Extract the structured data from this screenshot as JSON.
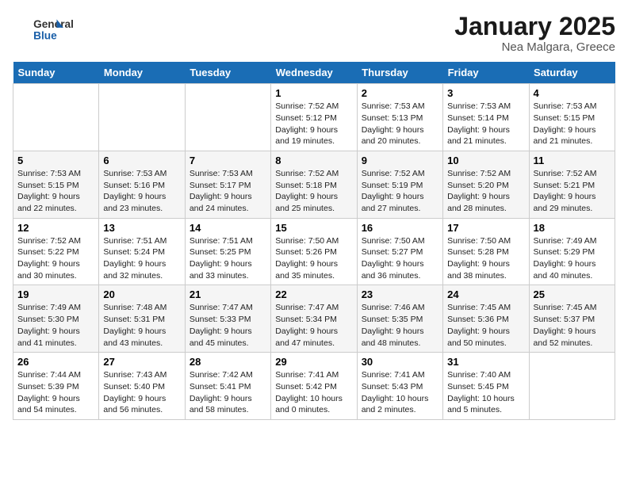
{
  "header": {
    "logo_general": "General",
    "logo_blue": "Blue",
    "title": "January 2025",
    "subtitle": "Nea Malgara, Greece"
  },
  "weekdays": [
    "Sunday",
    "Monday",
    "Tuesday",
    "Wednesday",
    "Thursday",
    "Friday",
    "Saturday"
  ],
  "weeks": [
    [
      {
        "day": "",
        "info": ""
      },
      {
        "day": "",
        "info": ""
      },
      {
        "day": "",
        "info": ""
      },
      {
        "day": "1",
        "info": "Sunrise: 7:52 AM\nSunset: 5:12 PM\nDaylight: 9 hours\nand 19 minutes."
      },
      {
        "day": "2",
        "info": "Sunrise: 7:53 AM\nSunset: 5:13 PM\nDaylight: 9 hours\nand 20 minutes."
      },
      {
        "day": "3",
        "info": "Sunrise: 7:53 AM\nSunset: 5:14 PM\nDaylight: 9 hours\nand 21 minutes."
      },
      {
        "day": "4",
        "info": "Sunrise: 7:53 AM\nSunset: 5:15 PM\nDaylight: 9 hours\nand 21 minutes."
      }
    ],
    [
      {
        "day": "5",
        "info": "Sunrise: 7:53 AM\nSunset: 5:15 PM\nDaylight: 9 hours\nand 22 minutes."
      },
      {
        "day": "6",
        "info": "Sunrise: 7:53 AM\nSunset: 5:16 PM\nDaylight: 9 hours\nand 23 minutes."
      },
      {
        "day": "7",
        "info": "Sunrise: 7:53 AM\nSunset: 5:17 PM\nDaylight: 9 hours\nand 24 minutes."
      },
      {
        "day": "8",
        "info": "Sunrise: 7:52 AM\nSunset: 5:18 PM\nDaylight: 9 hours\nand 25 minutes."
      },
      {
        "day": "9",
        "info": "Sunrise: 7:52 AM\nSunset: 5:19 PM\nDaylight: 9 hours\nand 27 minutes."
      },
      {
        "day": "10",
        "info": "Sunrise: 7:52 AM\nSunset: 5:20 PM\nDaylight: 9 hours\nand 28 minutes."
      },
      {
        "day": "11",
        "info": "Sunrise: 7:52 AM\nSunset: 5:21 PM\nDaylight: 9 hours\nand 29 minutes."
      }
    ],
    [
      {
        "day": "12",
        "info": "Sunrise: 7:52 AM\nSunset: 5:22 PM\nDaylight: 9 hours\nand 30 minutes."
      },
      {
        "day": "13",
        "info": "Sunrise: 7:51 AM\nSunset: 5:24 PM\nDaylight: 9 hours\nand 32 minutes."
      },
      {
        "day": "14",
        "info": "Sunrise: 7:51 AM\nSunset: 5:25 PM\nDaylight: 9 hours\nand 33 minutes."
      },
      {
        "day": "15",
        "info": "Sunrise: 7:50 AM\nSunset: 5:26 PM\nDaylight: 9 hours\nand 35 minutes."
      },
      {
        "day": "16",
        "info": "Sunrise: 7:50 AM\nSunset: 5:27 PM\nDaylight: 9 hours\nand 36 minutes."
      },
      {
        "day": "17",
        "info": "Sunrise: 7:50 AM\nSunset: 5:28 PM\nDaylight: 9 hours\nand 38 minutes."
      },
      {
        "day": "18",
        "info": "Sunrise: 7:49 AM\nSunset: 5:29 PM\nDaylight: 9 hours\nand 40 minutes."
      }
    ],
    [
      {
        "day": "19",
        "info": "Sunrise: 7:49 AM\nSunset: 5:30 PM\nDaylight: 9 hours\nand 41 minutes."
      },
      {
        "day": "20",
        "info": "Sunrise: 7:48 AM\nSunset: 5:31 PM\nDaylight: 9 hours\nand 43 minutes."
      },
      {
        "day": "21",
        "info": "Sunrise: 7:47 AM\nSunset: 5:33 PM\nDaylight: 9 hours\nand 45 minutes."
      },
      {
        "day": "22",
        "info": "Sunrise: 7:47 AM\nSunset: 5:34 PM\nDaylight: 9 hours\nand 47 minutes."
      },
      {
        "day": "23",
        "info": "Sunrise: 7:46 AM\nSunset: 5:35 PM\nDaylight: 9 hours\nand 48 minutes."
      },
      {
        "day": "24",
        "info": "Sunrise: 7:45 AM\nSunset: 5:36 PM\nDaylight: 9 hours\nand 50 minutes."
      },
      {
        "day": "25",
        "info": "Sunrise: 7:45 AM\nSunset: 5:37 PM\nDaylight: 9 hours\nand 52 minutes."
      }
    ],
    [
      {
        "day": "26",
        "info": "Sunrise: 7:44 AM\nSunset: 5:39 PM\nDaylight: 9 hours\nand 54 minutes."
      },
      {
        "day": "27",
        "info": "Sunrise: 7:43 AM\nSunset: 5:40 PM\nDaylight: 9 hours\nand 56 minutes."
      },
      {
        "day": "28",
        "info": "Sunrise: 7:42 AM\nSunset: 5:41 PM\nDaylight: 9 hours\nand 58 minutes."
      },
      {
        "day": "29",
        "info": "Sunrise: 7:41 AM\nSunset: 5:42 PM\nDaylight: 10 hours\nand 0 minutes."
      },
      {
        "day": "30",
        "info": "Sunrise: 7:41 AM\nSunset: 5:43 PM\nDaylight: 10 hours\nand 2 minutes."
      },
      {
        "day": "31",
        "info": "Sunrise: 7:40 AM\nSunset: 5:45 PM\nDaylight: 10 hours\nand 5 minutes."
      },
      {
        "day": "",
        "info": ""
      }
    ]
  ]
}
